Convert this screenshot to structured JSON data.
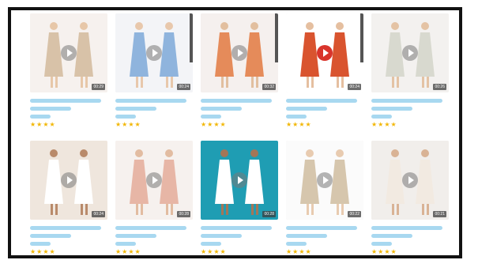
{
  "products": [
    {
      "duration": "00:29",
      "stars": "★★★★",
      "palette": {
        "bg": "#f6f1ee",
        "dress": "#d8c2a8",
        "skin": "#e7c7a8"
      },
      "accent_play": false,
      "rail": false
    },
    {
      "duration": "00:24",
      "stars": "★★★★",
      "palette": {
        "bg": "#f3f4f7",
        "dress": "#8fb4dd",
        "skin": "#e8c8ac"
      },
      "accent_play": false,
      "rail": true
    },
    {
      "duration": "00:32",
      "stars": "★★★★",
      "palette": {
        "bg": "#f5f0ee",
        "dress": "#e58b5a",
        "skin": "#e2bf9f"
      },
      "accent_play": false,
      "rail": true
    },
    {
      "duration": "00:24",
      "stars": "★★★★",
      "palette": {
        "bg": "#ffffff",
        "dress": "#d9542f",
        "skin": "#e5bfa0"
      },
      "accent_play": true,
      "rail": true
    },
    {
      "duration": "00:26",
      "stars": "★★★★",
      "palette": {
        "bg": "#f3f1ef",
        "dress": "#d8d9cf",
        "skin": "#e4c3a4"
      },
      "accent_play": false,
      "rail": false
    },
    {
      "duration": "00:24",
      "stars": "★★★★",
      "palette": {
        "bg": "#efe6dd",
        "dress": "#ffffff",
        "skin": "#b98a6a"
      },
      "accent_play": false,
      "rail": false
    },
    {
      "duration": "00:28",
      "stars": "★★★★",
      "palette": {
        "bg": "#f6f1ee",
        "dress": "#e7b6a6",
        "skin": "#e2bca1"
      },
      "accent_play": false,
      "rail": false
    },
    {
      "duration": "00:28",
      "stars": "★★★★",
      "palette": {
        "bg": "#1f9db3",
        "dress": "#ffffff",
        "skin": "#a47657"
      },
      "accent_play": false,
      "rail": false
    },
    {
      "duration": "00:22",
      "stars": "★★★★",
      "palette": {
        "bg": "#fbfbfb",
        "dress": "#d6c6ad",
        "skin": "#e8cbb0"
      },
      "accent_play": false,
      "rail": false
    },
    {
      "duration": "00:21",
      "stars": "★★★★",
      "palette": {
        "bg": "#f1eeeb",
        "dress": "#f2eae1",
        "skin": "#d9b395"
      },
      "accent_play": false,
      "rail": false
    }
  ]
}
